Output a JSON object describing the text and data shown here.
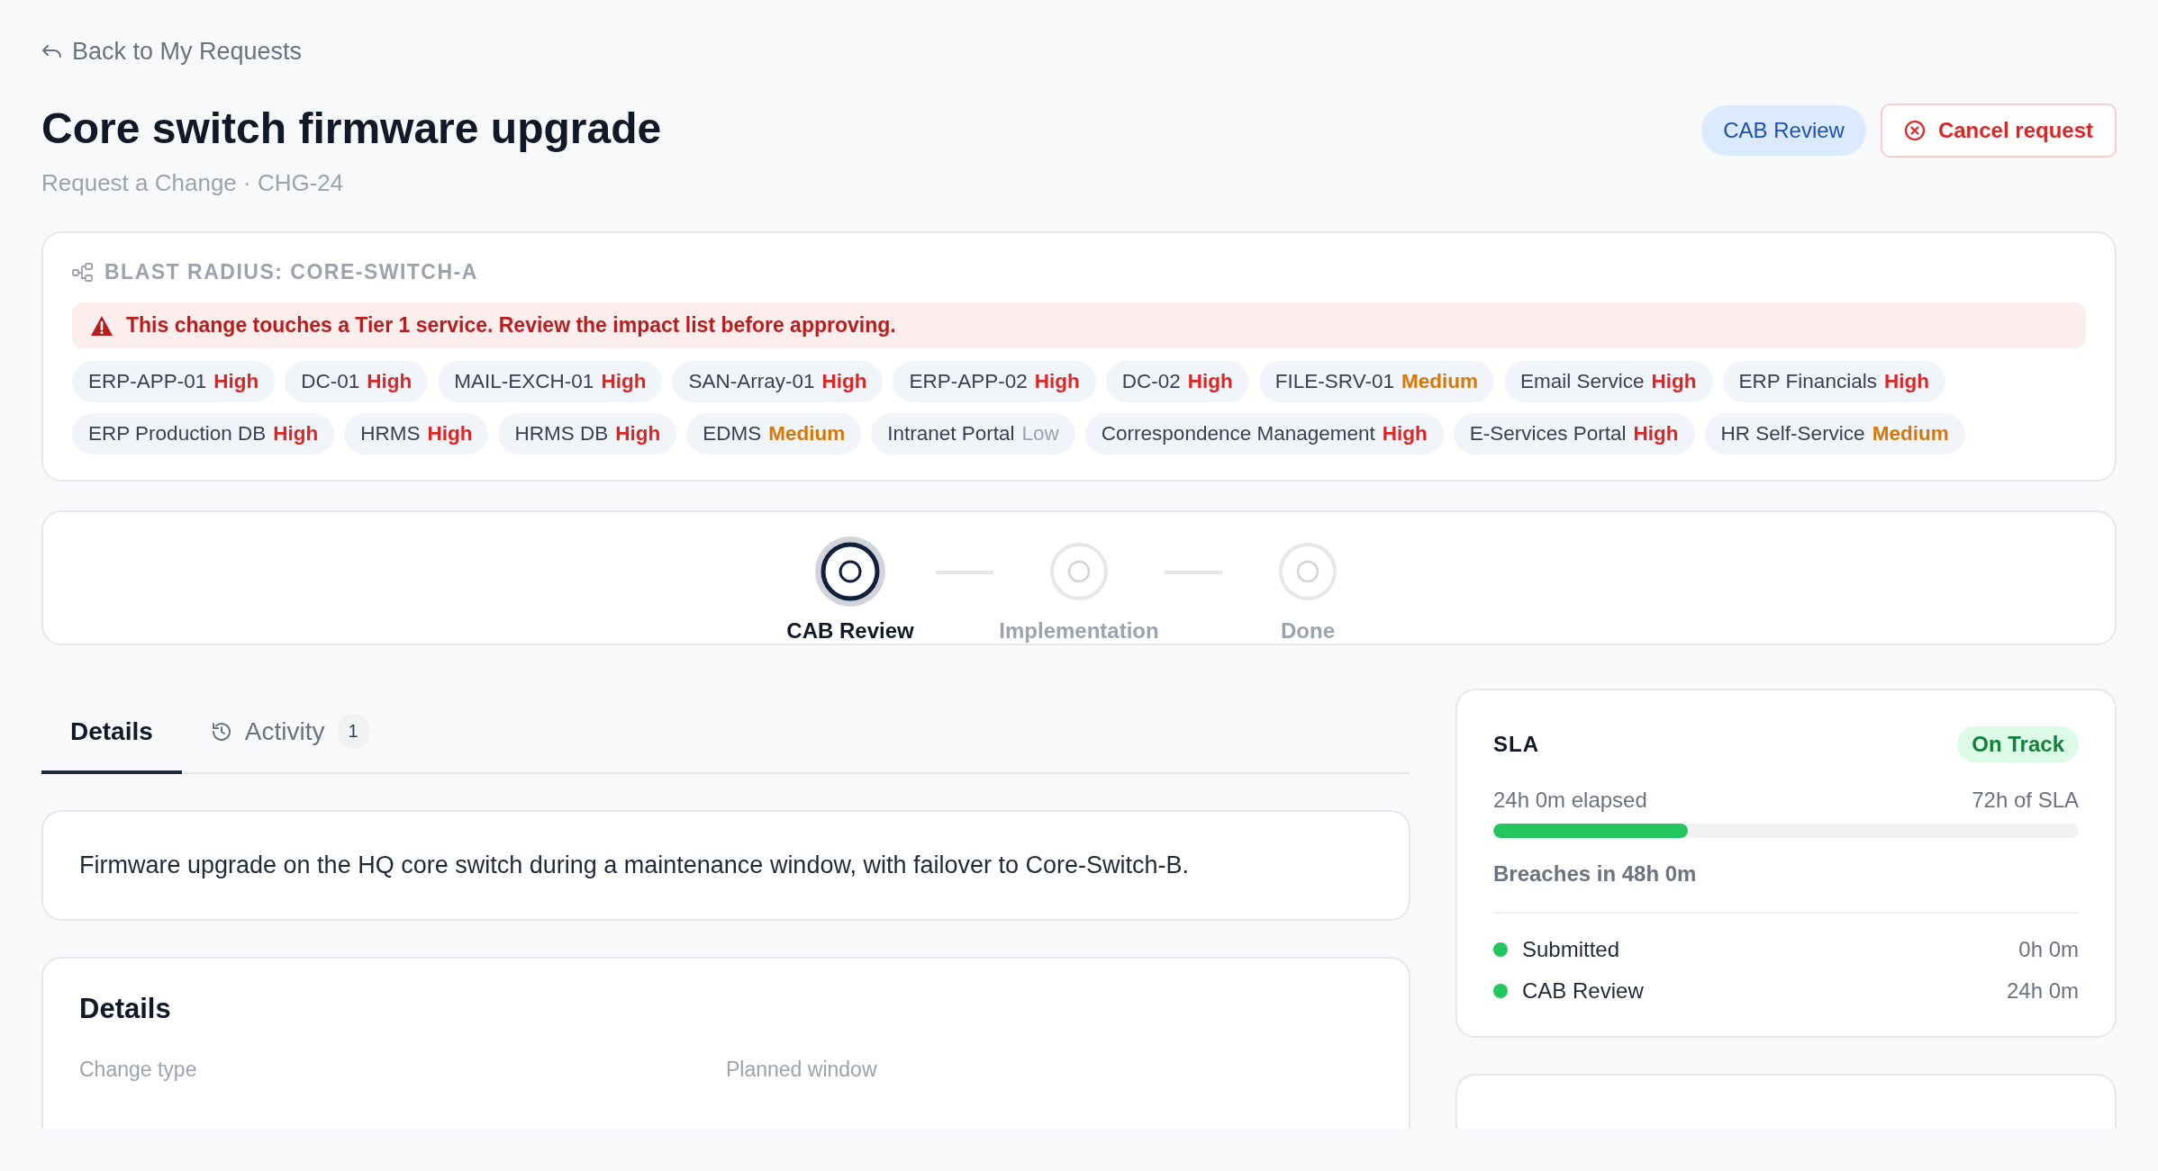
{
  "back_link": "Back to My Requests",
  "header": {
    "title": "Core switch firmware upgrade",
    "subtitle": "Request a Change · CHG-24",
    "status_badge": "CAB Review",
    "cancel_button": "Cancel request"
  },
  "blast_radius": {
    "title": "BLAST RADIUS: CORE-SWITCH-A",
    "alert": "This change touches a Tier 1 service. Review the impact list before approving.",
    "items": [
      {
        "name": "ERP-APP-01",
        "severity": "High",
        "kind": "high"
      },
      {
        "name": "DC-01",
        "severity": "High",
        "kind": "high"
      },
      {
        "name": "MAIL-EXCH-01",
        "severity": "High",
        "kind": "high"
      },
      {
        "name": "SAN-Array-01",
        "severity": "High",
        "kind": "high"
      },
      {
        "name": "ERP-APP-02",
        "severity": "High",
        "kind": "high"
      },
      {
        "name": "DC-02",
        "severity": "High",
        "kind": "high"
      },
      {
        "name": "FILE-SRV-01",
        "severity": "Medium",
        "kind": "medium"
      },
      {
        "name": "Email Service",
        "severity": "High",
        "kind": "high"
      },
      {
        "name": "ERP Financials",
        "severity": "High",
        "kind": "high"
      },
      {
        "name": "ERP Production DB",
        "severity": "High",
        "kind": "high"
      },
      {
        "name": "HRMS",
        "severity": "High",
        "kind": "high"
      },
      {
        "name": "HRMS DB",
        "severity": "High",
        "kind": "high"
      },
      {
        "name": "EDMS",
        "severity": "Medium",
        "kind": "medium"
      },
      {
        "name": "Intranet Portal",
        "severity": "Low",
        "kind": "low"
      },
      {
        "name": "Correspondence Management",
        "severity": "High",
        "kind": "high"
      },
      {
        "name": "E-Services Portal",
        "severity": "High",
        "kind": "high"
      },
      {
        "name": "HR Self-Service",
        "severity": "Medium",
        "kind": "medium"
      }
    ]
  },
  "stepper": [
    {
      "label": "CAB Review",
      "selected": true
    },
    {
      "label": "Implementation",
      "selected": false
    },
    {
      "label": "Done",
      "selected": false
    }
  ],
  "tabs": [
    {
      "label": "Details",
      "selected": true
    },
    {
      "label": "Activity",
      "selected": false,
      "count": "1"
    }
  ],
  "description": "Firmware upgrade on the HQ core switch during a maintenance window, with failover to Core-Switch-B.",
  "details": {
    "title": "Details",
    "fields": [
      {
        "label": "Change type"
      },
      {
        "label": "Planned window"
      }
    ]
  },
  "sla": {
    "title": "SLA",
    "status": "On Track",
    "elapsed": "24h 0m elapsed",
    "total": "72h of SLA",
    "level": 0.333,
    "breach": "Breaches in 48h 0m",
    "timeline": [
      {
        "label": "Submitted",
        "time": "0h 0m",
        "color": "#22c55e"
      },
      {
        "label": "CAB Review",
        "time": "24h 0m",
        "color": "#22c55e"
      }
    ]
  }
}
